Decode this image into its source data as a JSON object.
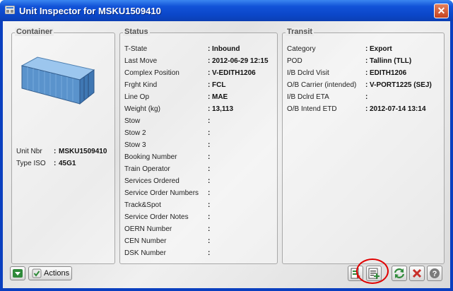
{
  "window": {
    "title": "Unit Inspector for MSKU1509410",
    "close_label": "✕"
  },
  "container": {
    "title": "Container",
    "fields": [
      {
        "label": "Unit Nbr",
        "value": "MSKU1509410"
      },
      {
        "label": "Type ISO",
        "value": "45G1"
      }
    ]
  },
  "status": {
    "title": "Status",
    "fields": [
      {
        "label": "T-State",
        "value": "Inbound"
      },
      {
        "label": "Last Move",
        "value": "2012-06-29 12:15"
      },
      {
        "label": "Complex Position",
        "value": "V-EDITH1206"
      },
      {
        "label": "Frght Kind",
        "value": "FCL"
      },
      {
        "label": "Line Op",
        "value": "MAE"
      },
      {
        "label": "Weight (kg)",
        "value": "13,113"
      },
      {
        "label": "Stow",
        "value": ""
      },
      {
        "label": "Stow 2",
        "value": ""
      },
      {
        "label": "Stow 3",
        "value": ""
      },
      {
        "label": "Booking Number",
        "value": ""
      },
      {
        "label": "Train Operator",
        "value": ""
      },
      {
        "label": "Services Ordered",
        "value": ""
      },
      {
        "label": "Service Order Numbers",
        "value": ""
      },
      {
        "label": "Track&Spot",
        "value": ""
      },
      {
        "label": "Service Order Notes",
        "value": ""
      },
      {
        "label": "OERN Number",
        "value": ""
      },
      {
        "label": "CEN Number",
        "value": ""
      },
      {
        "label": "DSK Number",
        "value": ""
      }
    ]
  },
  "transit": {
    "title": "Transit",
    "fields": [
      {
        "label": "Category",
        "value": "Export"
      },
      {
        "label": "POD",
        "value": "Tallinn (TLL)"
      },
      {
        "label": "I/B Dclrd Visit",
        "value": "EDITH1206"
      },
      {
        "label": "O/B Carrier (intended)",
        "value": "V-PORT1225 (SEJ)"
      },
      {
        "label": "I/B Dclrd ETA",
        "value": ""
      },
      {
        "label": "O/B Intend ETD",
        "value": "2012-07-14 13:14"
      }
    ]
  },
  "separator": ":",
  "footer": {
    "actions_label": "Actions"
  },
  "colors": {
    "titlebar": "#0b47c9",
    "highlight_circle": "#e00000",
    "close_button": "#c6431f"
  }
}
